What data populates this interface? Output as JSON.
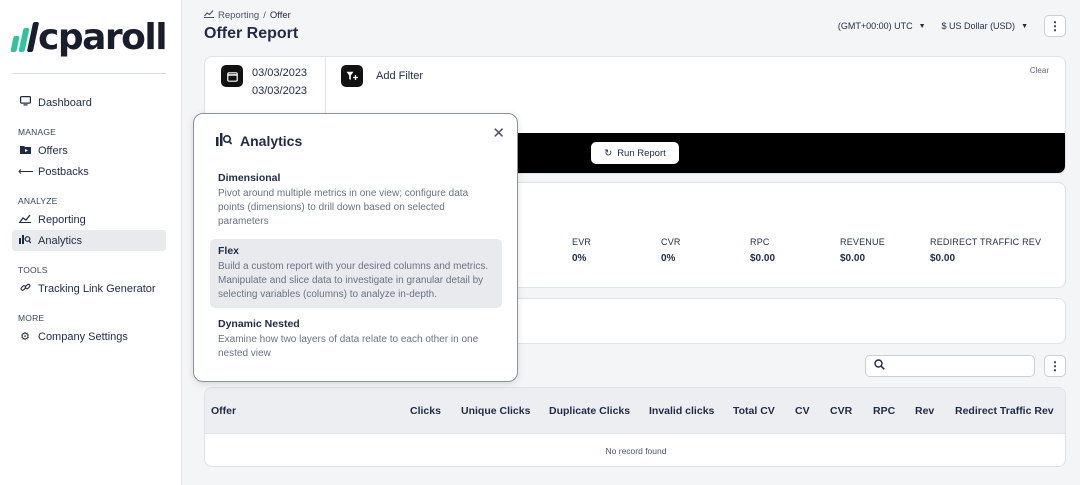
{
  "brand": {
    "logo_text": "cparoll",
    "bar_colors": [
      "#2ec4a0",
      "#2ec4a0",
      "#1a1d2b"
    ]
  },
  "sidebar": {
    "items_top": [
      {
        "label": "Dashboard",
        "icon": "monitor-icon"
      }
    ],
    "sections": [
      {
        "title": "MANAGE",
        "items": [
          {
            "label": "Offers",
            "icon": "folder-icon"
          },
          {
            "label": "Postbacks",
            "icon": "arrow-left-icon"
          }
        ]
      },
      {
        "title": "ANALYZE",
        "items": [
          {
            "label": "Reporting",
            "icon": "chart-icon"
          },
          {
            "label": "Analytics",
            "icon": "analytics-icon",
            "active": true
          }
        ]
      },
      {
        "title": "TOOLS",
        "items": [
          {
            "label": "Tracking Link Generator",
            "icon": "link-icon"
          }
        ]
      },
      {
        "title": "MORE",
        "items": [
          {
            "label": "Company Settings",
            "icon": "gear-icon"
          }
        ]
      }
    ]
  },
  "header": {
    "breadcrumb_parent": "Reporting",
    "breadcrumb_sep": "/",
    "breadcrumb_current": "Offer",
    "title": "Offer Report",
    "timezone": "(GMT+00:00) UTC",
    "currency": "$ US Dollar (USD)"
  },
  "filter": {
    "date_start": "03/03/2023",
    "date_end": "03/03/2023",
    "add_filter_label": "Add Filter",
    "clear_label": "Clear",
    "run_label": "Run Report"
  },
  "stats": [
    {
      "label": "EVR",
      "value": "0%"
    },
    {
      "label": "CVR",
      "value": "0%"
    },
    {
      "label": "RPC",
      "value": "$0.00"
    },
    {
      "label": "REVENUE",
      "value": "$0.00"
    },
    {
      "label": "REDIRECT TRAFFIC REV",
      "value": "$0.00"
    }
  ],
  "search": {
    "placeholder": ""
  },
  "table": {
    "columns": [
      "Offer",
      "Clicks",
      "Unique Clicks",
      "Duplicate Clicks",
      "Invalid clicks",
      "Total CV",
      "CV",
      "CVR",
      "RPC",
      "Rev",
      "Redirect Traffic Rev"
    ],
    "empty_text": "No record found"
  },
  "popover": {
    "title": "Analytics",
    "items": [
      {
        "title": "Dimensional",
        "desc": "Pivot around multiple metrics in one view; configure data points (dimensions) to drill down based on selected parameters"
      },
      {
        "title": "Flex",
        "desc": "Build a custom report with your desired columns and metrics. Manipulate and slice data to investigate in granular detail by selecting variables (columns) to analyze in-depth."
      },
      {
        "title": "Dynamic Nested",
        "desc": "Examine how two layers of data relate to each other in one nested view"
      }
    ]
  }
}
